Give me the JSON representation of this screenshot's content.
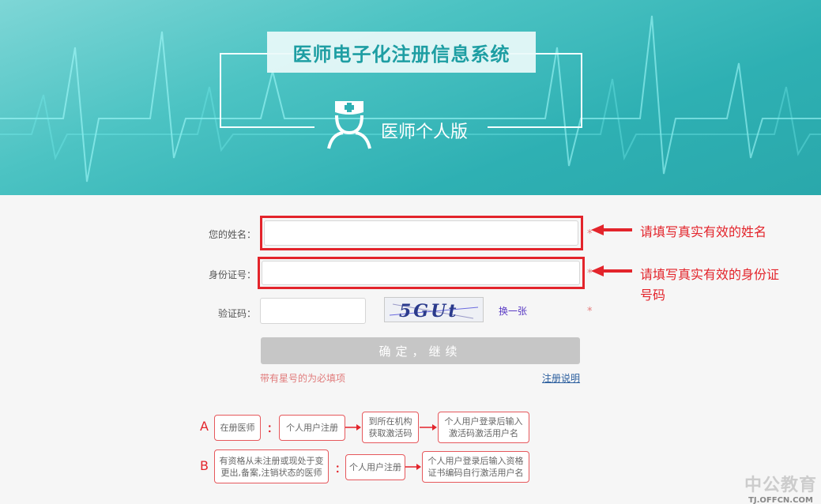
{
  "header": {
    "system_title": "医师电子化注册信息系统",
    "edition": "医师个人版"
  },
  "form": {
    "name_label": "您的姓名：",
    "name_value": "",
    "id_label": "身份证号：",
    "id_value": "",
    "captcha_label": "验证码：",
    "captcha_value": "",
    "captcha_text": "5GUt",
    "swap_captcha": "换一张",
    "asterisk": "*",
    "submit_label": "确定，继续",
    "required_hint": "带有星号的为必填项",
    "register_help": "注册说明"
  },
  "annotations": {
    "name_note": "请填写真实有效的姓名",
    "id_note_line1": "请填写真实有效的身份证",
    "id_note_line2": "号码"
  },
  "flow": {
    "a": {
      "letter": "A",
      "type": "在册医师",
      "steps": [
        "个人用户注册",
        "到所在机构\n获取激活码",
        "个人用户登录后输入\n激活码激活用户名"
      ]
    },
    "b": {
      "letter": "B",
      "type": "有资格从未注册或现处于变\n更出,备案,注销状态的医师",
      "steps": [
        "个人用户注册",
        "个人用户登录后输入资格\n证书编码自行激活用户名"
      ]
    },
    "colon": "："
  },
  "watermark": {
    "logo": "中公教育",
    "site": "TJ.OFFCN.COM"
  },
  "colors": {
    "banner": "#2eb0b3",
    "title_text": "#1e9ea3",
    "annotation_red": "#e3242b",
    "submit_bg": "#c6c6c6"
  }
}
